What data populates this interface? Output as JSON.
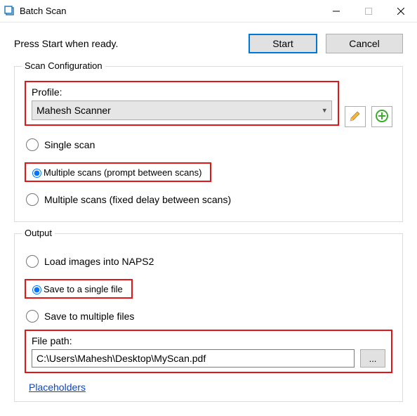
{
  "window": {
    "title": "Batch Scan"
  },
  "top": {
    "prompt": "Press Start when ready.",
    "start": "Start",
    "cancel": "Cancel"
  },
  "scanConfig": {
    "legend": "Scan Configuration",
    "profileLabel": "Profile:",
    "profileValue": "Mahesh Scanner",
    "editIcon": "pencil-icon",
    "addIcon": "plus-icon",
    "radios": {
      "single": "Single scan",
      "multiPrompt": "Multiple scans (prompt between scans)",
      "multiDelay": "Multiple scans (fixed delay between scans)"
    },
    "selected": "multiPrompt"
  },
  "output": {
    "legend": "Output",
    "radios": {
      "load": "Load images into NAPS2",
      "single": "Save to a single file",
      "multi": "Save to multiple files"
    },
    "selected": "single",
    "filePathLabel": "File path:",
    "filePathValue": "C:\\Users\\Mahesh\\Desktop\\MyScan.pdf",
    "browse": "...",
    "placeholders": "Placeholders"
  }
}
